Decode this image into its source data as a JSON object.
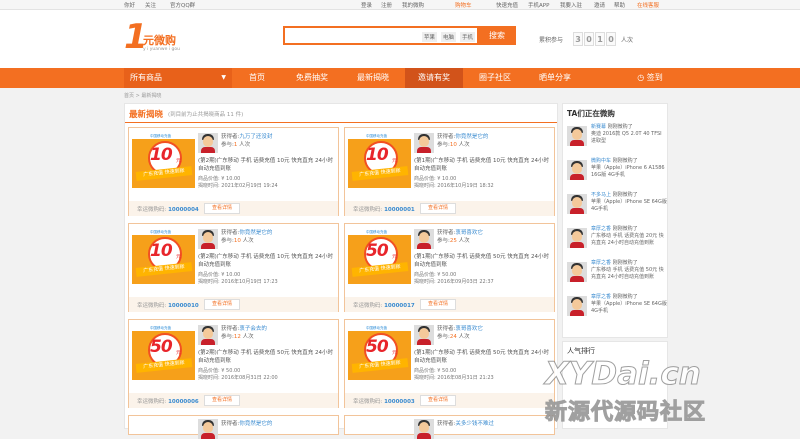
{
  "topbar": {
    "left": [
      "你好",
      "关注",
      "官方QQ群"
    ],
    "right": [
      "登录",
      "注册",
      "我的微购",
      "购物车",
      "快速充值",
      "手机APP",
      "我要入驻",
      "邀请",
      "帮助",
      "在线客服"
    ]
  },
  "header": {
    "logo_main": "1",
    "logo_text": "元微购",
    "logo_sub": "y i yuanwe i gou",
    "search_tags": [
      "苹果",
      "电脑",
      "手机"
    ],
    "search_button": "搜索",
    "count_label": "累积参与",
    "count_digits": [
      "3",
      "0",
      "1",
      "0"
    ],
    "count_unit": "人次"
  },
  "nav": {
    "all_label": "所有商品",
    "items": [
      "首页",
      "免费抽奖",
      "最新揭晓",
      "邀请有奖",
      "圈子社区",
      "晒单分享",
      "签到"
    ]
  },
  "breadcrumb": "首页 > 最新揭晓",
  "main": {
    "title": "最新揭晓",
    "subtitle": "(到目前为止共揭晓商品 11 件)",
    "cards": [
      {
        "winner_label": "获得者:",
        "winner": "九万了还没封",
        "join_label": "参与:",
        "join": "1",
        "join_unit": "人次",
        "face": "10",
        "desc": "(第2期)广东移动  手机  话费充值  10元  快充直充  24小时自动充值到账",
        "price": "商品价值: ¥ 10.00",
        "time": "揭晓时间: 2021年02月19日 19:24",
        "code_label": "幸运微购码:",
        "code": "10000004",
        "btn": "查看详情"
      },
      {
        "winner_label": "获得者:",
        "winner": "你竟然是它的",
        "join_label": "参与:",
        "join": "10",
        "join_unit": "人次",
        "face": "10",
        "desc": "(第1期)广东移动  手机  话费充值  10元  快充直充  24小时自动充值到账",
        "price": "商品价值: ¥ 10.00",
        "time": "揭晓时间: 2016年10月19日 18:32",
        "code_label": "幸运微购码:",
        "code": "10000001",
        "btn": "查看详情"
      },
      {
        "winner_label": "获得者:",
        "winner": "你竟然是它的",
        "join_label": "参与:",
        "join": "10",
        "join_unit": "人次",
        "face": "10",
        "desc": "(第2期)广东移动  手机  话费充值  10元  快充直充  24小时自动充值到账",
        "price": "商品价值: ¥ 10.00",
        "time": "揭晓时间: 2016年10月19日 17:23",
        "code_label": "幸运微购码:",
        "code": "10000010",
        "btn": "查看详情"
      },
      {
        "winner_label": "获得者:",
        "winner": "衷哥喜欢它",
        "join_label": "参与:",
        "join": "25",
        "join_unit": "人次",
        "face": "50",
        "desc": "(第1期)广东移动  手机  话费充值  50元  快充直充  24小时自动充值到账",
        "price": "商品价值: ¥ 50.00",
        "time": "揭晓时间: 2016年09月03日 22:37",
        "code_label": "幸运微购码:",
        "code": "10000017",
        "btn": "查看详情"
      },
      {
        "winner_label": "获得者:",
        "winner": "衷子会去的",
        "join_label": "参与:",
        "join": "12",
        "join_unit": "人次",
        "face": "50",
        "desc": "(第2期)广东移动  手机  话费充值  50元  快充直充  24小时自动充值到账",
        "price": "商品价值: ¥ 50.00",
        "time": "揭晓时间: 2016年08月31日 22:00",
        "code_label": "幸运微购码:",
        "code": "10000006",
        "btn": "查看详情"
      },
      {
        "winner_label": "获得者:",
        "winner": "衷哥喜欢它",
        "join_label": "参与:",
        "join": "24",
        "join_unit": "人次",
        "face": "50",
        "desc": "(第1期)广东移动  手机  话费充值  50元  快充直充  24小时自动充值到账",
        "price": "商品价值: ¥ 50.00",
        "time": "揭晓时间: 2016年08月31日 21:23",
        "code_label": "幸运微购码:",
        "code": "10000003",
        "btn": "查看详情"
      }
    ],
    "card_tophead": "中国移动充值",
    "card_ribbon": "广东充值  快速到账",
    "card_yuan": "元",
    "partial": [
      {
        "winner_label": "获得者:",
        "winner": "你竟然是它的"
      },
      {
        "winner_label": "获得者:",
        "winner": "关多少钱不难过"
      }
    ]
  },
  "side": {
    "title": "TA们正在微购",
    "items": [
      {
        "name": "新赛幕",
        "action": "刚刚微购了",
        "product": "奥迪 2016款 Q5 2.0T 40 TFSI 进取型"
      },
      {
        "name": "微购中车",
        "action": "刚刚微购了",
        "product": "苹果（Apple）iPhone 6 A1586 16G版 4G手机"
      },
      {
        "name": "不多马上",
        "action": "刚刚微购了",
        "product": "苹果（Apple）iPhone SE 64G版 4G手机"
      },
      {
        "name": "章厚之香",
        "action": "刚刚微购了",
        "product": "广东移动 手机 话费充值 20元 快充直充 24小时自动充值到账"
      },
      {
        "name": "章厚之香",
        "action": "刚刚微购了",
        "product": "广东移动 手机 话费充值 50元 快充直充 24小时自动充值到账"
      },
      {
        "name": "章厚之香",
        "action": "刚刚微购了",
        "product": "苹果（Apple）iPhone SE 64G版 4G手机"
      }
    ],
    "rank_title": "人气排行"
  },
  "watermark": {
    "line1": "XYDai.cn",
    "line2": "新源代源码社区"
  }
}
